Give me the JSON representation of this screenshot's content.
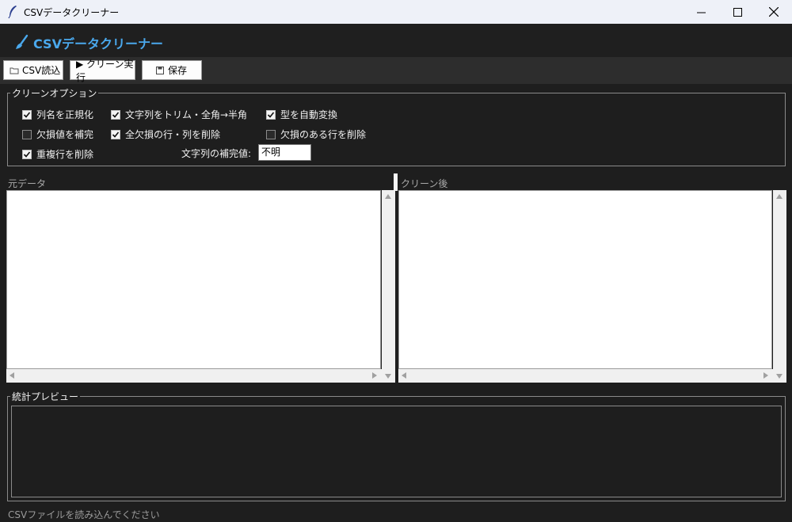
{
  "window": {
    "title": "CSVデータクリーナー"
  },
  "header": {
    "title": "CSVデータクリーナー"
  },
  "toolbar": {
    "load_label": "CSV読込",
    "run_label": "▶ クリーン実行",
    "save_label": "保存"
  },
  "options": {
    "legend": "クリーンオプション",
    "items": [
      {
        "label": "列名を正規化",
        "checked": true
      },
      {
        "label": "文字列をトリム・全角→半角",
        "checked": true
      },
      {
        "label": "型を自動変換",
        "checked": true
      },
      {
        "label": "欠損値を補完",
        "checked": false
      },
      {
        "label": "全欠損の行・列を削除",
        "checked": true
      },
      {
        "label": "欠損のある行を削除",
        "checked": false
      },
      {
        "label": "重複行を削除",
        "checked": true
      }
    ],
    "fill_label": "文字列の補完値:",
    "fill_value": "不明"
  },
  "panes": {
    "original_label": "元データ",
    "cleaned_label": "クリーン後"
  },
  "stats": {
    "legend": "統計プレビュー"
  },
  "status": {
    "text": "CSVファイルを読み込んでください"
  },
  "colors": {
    "accent": "#4aa8ec",
    "background": "#1e1e1e",
    "toolbar": "#2d2d2d"
  }
}
